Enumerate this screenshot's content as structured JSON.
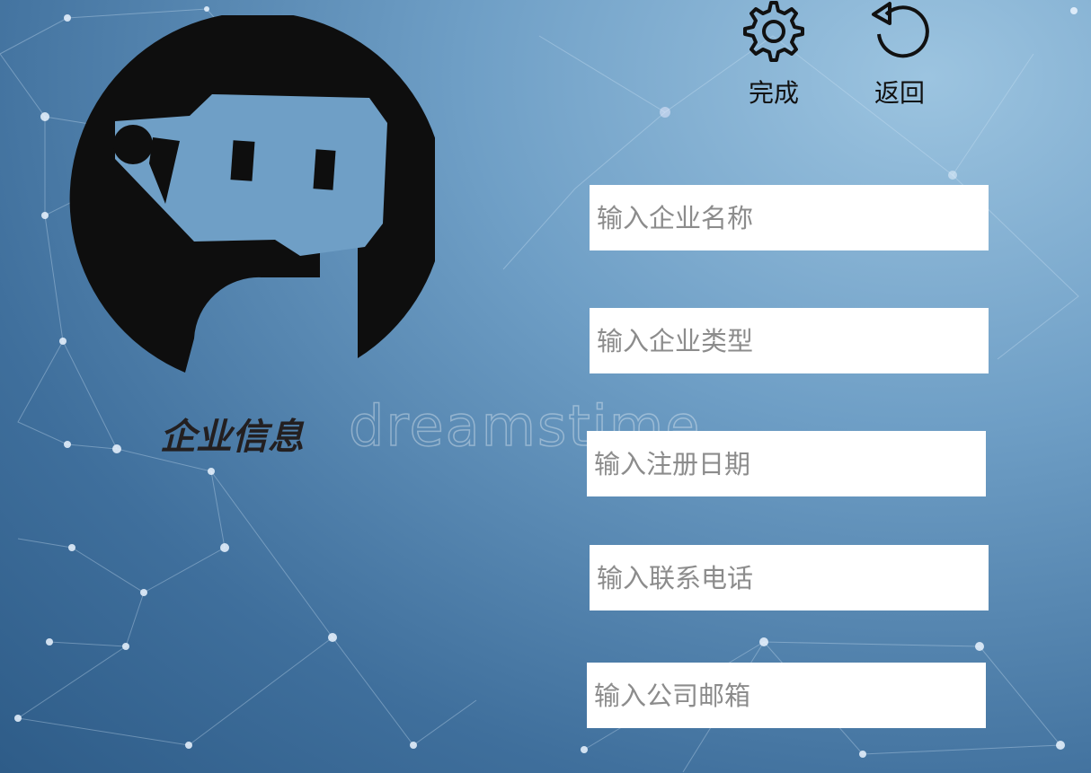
{
  "actions": {
    "done_label": "完成",
    "back_label": "返回"
  },
  "profile": {
    "title": "企业信息"
  },
  "watermark": "dreamstime",
  "form": {
    "company_name_placeholder": "输入企业名称",
    "company_type_placeholder": "输入企业类型",
    "register_date_placeholder": "输入注册日期",
    "phone_placeholder": "输入联系电话",
    "email_placeholder": "输入公司邮箱"
  },
  "colors": {
    "bg_light": "#9cc4e0",
    "bg_dark": "#2e5c88",
    "avatar": "#0e0e0e",
    "field_bg": "#ffffff"
  },
  "icons": {
    "done": "gear-icon",
    "back": "undo-icon",
    "avatar": "robot-avatar-icon"
  }
}
